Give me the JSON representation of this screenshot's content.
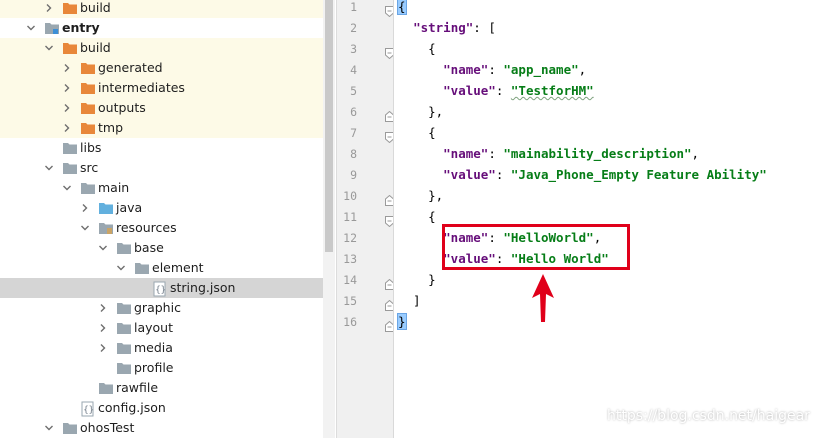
{
  "project_tree": {
    "items": [
      {
        "label": "build",
        "icon": "folder-orange-icon",
        "expanded": false,
        "highlight": true
      },
      {
        "label": "entry",
        "icon": "module-folder-icon",
        "expanded": true,
        "bold": true
      },
      {
        "label": "build",
        "icon": "folder-orange-icon",
        "expanded": true,
        "highlight": true
      },
      {
        "label": "generated",
        "icon": "folder-orange-icon",
        "expanded": false,
        "highlight": true
      },
      {
        "label": "intermediates",
        "icon": "folder-orange-icon",
        "expanded": false,
        "highlight": true
      },
      {
        "label": "outputs",
        "icon": "folder-orange-icon",
        "expanded": false,
        "highlight": true
      },
      {
        "label": "tmp",
        "icon": "folder-orange-icon",
        "expanded": false,
        "highlight": true
      },
      {
        "label": "libs",
        "icon": "folder-gray-icon"
      },
      {
        "label": "src",
        "icon": "folder-gray-icon",
        "expanded": true
      },
      {
        "label": "main",
        "icon": "folder-gray-icon",
        "expanded": true
      },
      {
        "label": "java",
        "icon": "folder-blue-icon",
        "expanded": false
      },
      {
        "label": "resources",
        "icon": "resources-folder-icon",
        "expanded": true
      },
      {
        "label": "base",
        "icon": "folder-gray-icon",
        "expanded": true
      },
      {
        "label": "element",
        "icon": "folder-gray-icon",
        "expanded": true
      },
      {
        "label": "string.json",
        "icon": "json-file-icon",
        "selected": true
      },
      {
        "label": "graphic",
        "icon": "folder-gray-icon",
        "expanded": false
      },
      {
        "label": "layout",
        "icon": "folder-gray-icon",
        "expanded": false
      },
      {
        "label": "media",
        "icon": "folder-gray-icon",
        "expanded": false
      },
      {
        "label": "profile",
        "icon": "folder-gray-icon"
      },
      {
        "label": "rawfile",
        "icon": "folder-gray-icon"
      },
      {
        "label": "config.json",
        "icon": "json-file-icon"
      },
      {
        "label": "ohosTest",
        "icon": "folder-gray-icon",
        "expanded": true
      }
    ]
  },
  "editor": {
    "line_numbers": [
      "1",
      "2",
      "3",
      "4",
      "5",
      "6",
      "7",
      "8",
      "9",
      "10",
      "11",
      "12",
      "13",
      "14",
      "15",
      "16"
    ],
    "lines": [
      [
        {
          "t": "{",
          "c": "brace"
        }
      ],
      [
        {
          "t": "  ",
          "c": "pun"
        },
        {
          "t": "\"string\"",
          "c": "key"
        },
        {
          "t": ": [",
          "c": "pun"
        }
      ],
      [
        {
          "t": "    {",
          "c": "pun"
        }
      ],
      [
        {
          "t": "      ",
          "c": "pun"
        },
        {
          "t": "\"name\"",
          "c": "key"
        },
        {
          "t": ": ",
          "c": "pun"
        },
        {
          "t": "\"app_name\"",
          "c": "str"
        },
        {
          "t": ",",
          "c": "pun"
        }
      ],
      [
        {
          "t": "      ",
          "c": "pun"
        },
        {
          "t": "\"value\"",
          "c": "key"
        },
        {
          "t": ": ",
          "c": "pun"
        },
        {
          "t": "\"TestforHM\"",
          "c": "str squig"
        }
      ],
      [
        {
          "t": "    },",
          "c": "pun"
        }
      ],
      [
        {
          "t": "    {",
          "c": "pun"
        }
      ],
      [
        {
          "t": "      ",
          "c": "pun"
        },
        {
          "t": "\"name\"",
          "c": "key"
        },
        {
          "t": ": ",
          "c": "pun"
        },
        {
          "t": "\"mainability_description\"",
          "c": "str"
        },
        {
          "t": ",",
          "c": "pun"
        }
      ],
      [
        {
          "t": "      ",
          "c": "pun"
        },
        {
          "t": "\"value\"",
          "c": "key"
        },
        {
          "t": ": ",
          "c": "pun"
        },
        {
          "t": "\"Java_Phone_Empty Feature Ability\"",
          "c": "str"
        }
      ],
      [
        {
          "t": "    },",
          "c": "pun"
        }
      ],
      [
        {
          "t": "    {",
          "c": "pun"
        }
      ],
      [
        {
          "t": "      ",
          "c": "pun"
        },
        {
          "t": "\"name\"",
          "c": "key"
        },
        {
          "t": ": ",
          "c": "pun"
        },
        {
          "t": "\"HelloWorld\"",
          "c": "str"
        },
        {
          "t": ",",
          "c": "pun"
        }
      ],
      [
        {
          "t": "      ",
          "c": "pun"
        },
        {
          "t": "\"value\"",
          "c": "key"
        },
        {
          "t": ": ",
          "c": "pun"
        },
        {
          "t": "\"Hello World\"",
          "c": "str"
        }
      ],
      [
        {
          "t": "    }",
          "c": "pun"
        }
      ],
      [
        {
          "t": "  ]",
          "c": "pun"
        }
      ],
      [
        {
          "t": "}",
          "c": "brace"
        }
      ]
    ]
  },
  "watermark": "https://blog.csdn.net/haigear",
  "colors": {
    "annotation_red": "#e0001a",
    "json_key": "#660e7a",
    "json_string": "#067d17",
    "tree_highlight": "#fdfae7",
    "selection": "#d5d5d5"
  }
}
